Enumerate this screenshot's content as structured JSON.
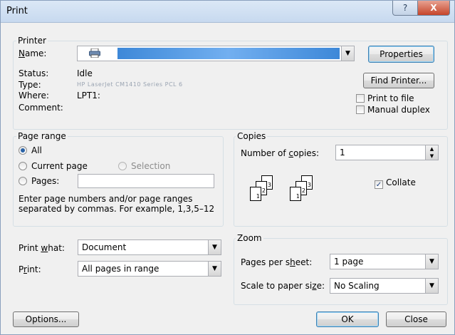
{
  "window": {
    "title": "Print",
    "help_glyph": "?",
    "close_glyph": "X"
  },
  "printer": {
    "group_label": "Printer",
    "name_label": "Name:",
    "status_label": "Status:",
    "status_value": "Idle",
    "type_label": "Type:",
    "type_value": "HP LaserJet CM1410 Series PCL 6",
    "where_label": "Where:",
    "where_value": "LPT1:",
    "comment_label": "Comment:",
    "properties_button": "Properties",
    "find_printer_button": "Find Printer...",
    "print_to_file_label": "Print to file",
    "print_to_file_checked": false,
    "manual_duplex_label": "Manual duplex",
    "manual_duplex_checked": false
  },
  "page_range": {
    "group_label": "Page range",
    "all_label": "All",
    "current_page_label": "Current page",
    "selection_label": "Selection",
    "pages_label": "Pages:",
    "pages_value": "",
    "selected": "all",
    "hint": "Enter page numbers and/or page ranges separated by commas.  For example, 1,3,5–12"
  },
  "copies": {
    "group_label": "Copies",
    "number_label": "Number of copies:",
    "number_value": "1",
    "collate_label": "Collate",
    "collate_checked": true,
    "page_glyphs": [
      "3",
      "2",
      "1",
      "3",
      "2",
      "1"
    ]
  },
  "print_what": {
    "label": "Print what:",
    "value": "Document"
  },
  "print_range": {
    "label": "Print:",
    "value": "All pages in range"
  },
  "zoom": {
    "group_label": "Zoom",
    "pages_per_sheet_label": "Pages per sheet:",
    "pages_per_sheet_value": "1 page",
    "scale_label": "Scale to paper size:",
    "scale_value": "No Scaling"
  },
  "footer": {
    "options_button": "Options...",
    "ok_button": "OK",
    "close_button": "Close"
  },
  "colors": {
    "accent": "#3c7fb1",
    "title_bar": "#c7d9ef",
    "dialog_bg": "#f0f0f0"
  }
}
